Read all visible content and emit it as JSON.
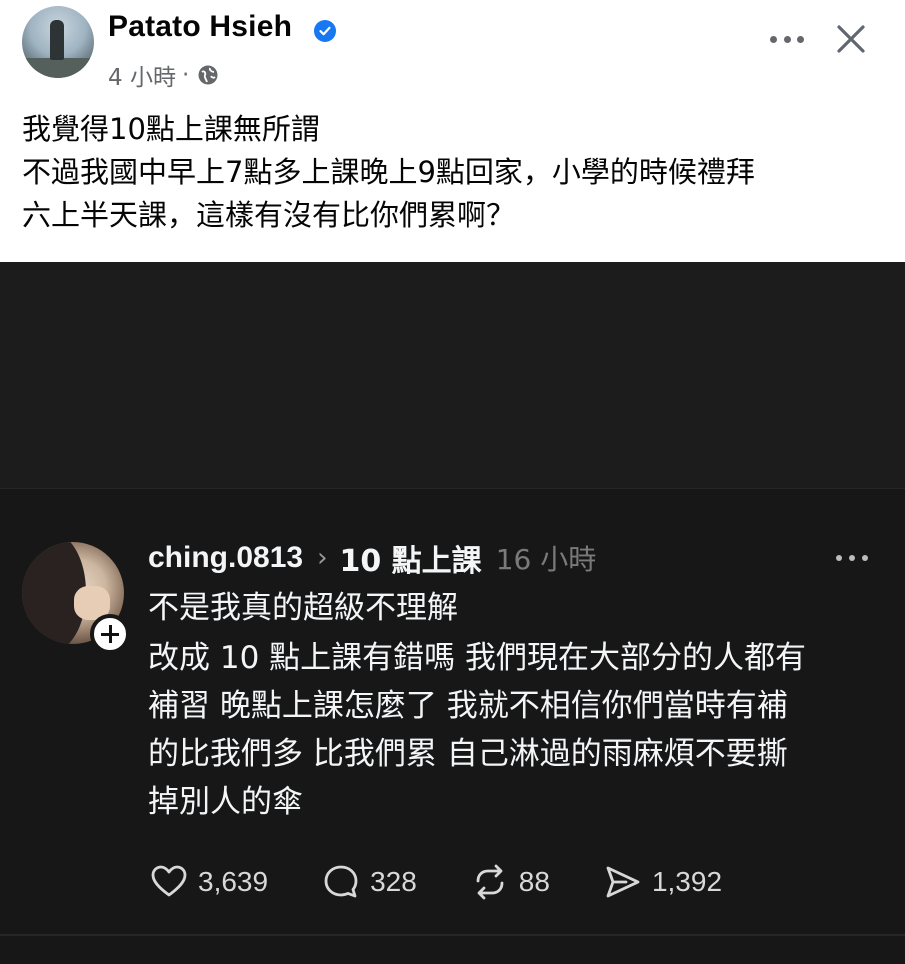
{
  "post": {
    "author": "Patato Hsieh",
    "time": "4 小時",
    "separator": "·",
    "icons": {
      "verified": "verified-badge-icon",
      "audience": "globe-icon",
      "more": "more-options-icon",
      "close": "close-icon"
    },
    "text_lines": [
      "我覺得10點上課無所謂",
      "不過我國中早上7點多上課晚上9點回家，小學的時候禮拜",
      "六上半天課，這樣有沒有比你們累啊？"
    ]
  },
  "embedded": {
    "username": "ching.0813",
    "topic": "10 點上課",
    "time": "16 小時",
    "lines": [
      "不是我真的超級不理解",
      "改成 10 點上課有錯嗎 我們現在大部分的人都有",
      "補習 晚點上課怎麼了 我就不相信你們當時有補",
      "的比我們多 比我們累 自己淋過的雨麻煩不要撕",
      "掉別人的傘"
    ],
    "stats": {
      "likes": "3,639",
      "replies": "328",
      "reposts": "88",
      "shares": "1,392"
    },
    "colors": {
      "background": "#171717",
      "text": "#f3f5f7",
      "muted": "#7a7a7a"
    }
  }
}
